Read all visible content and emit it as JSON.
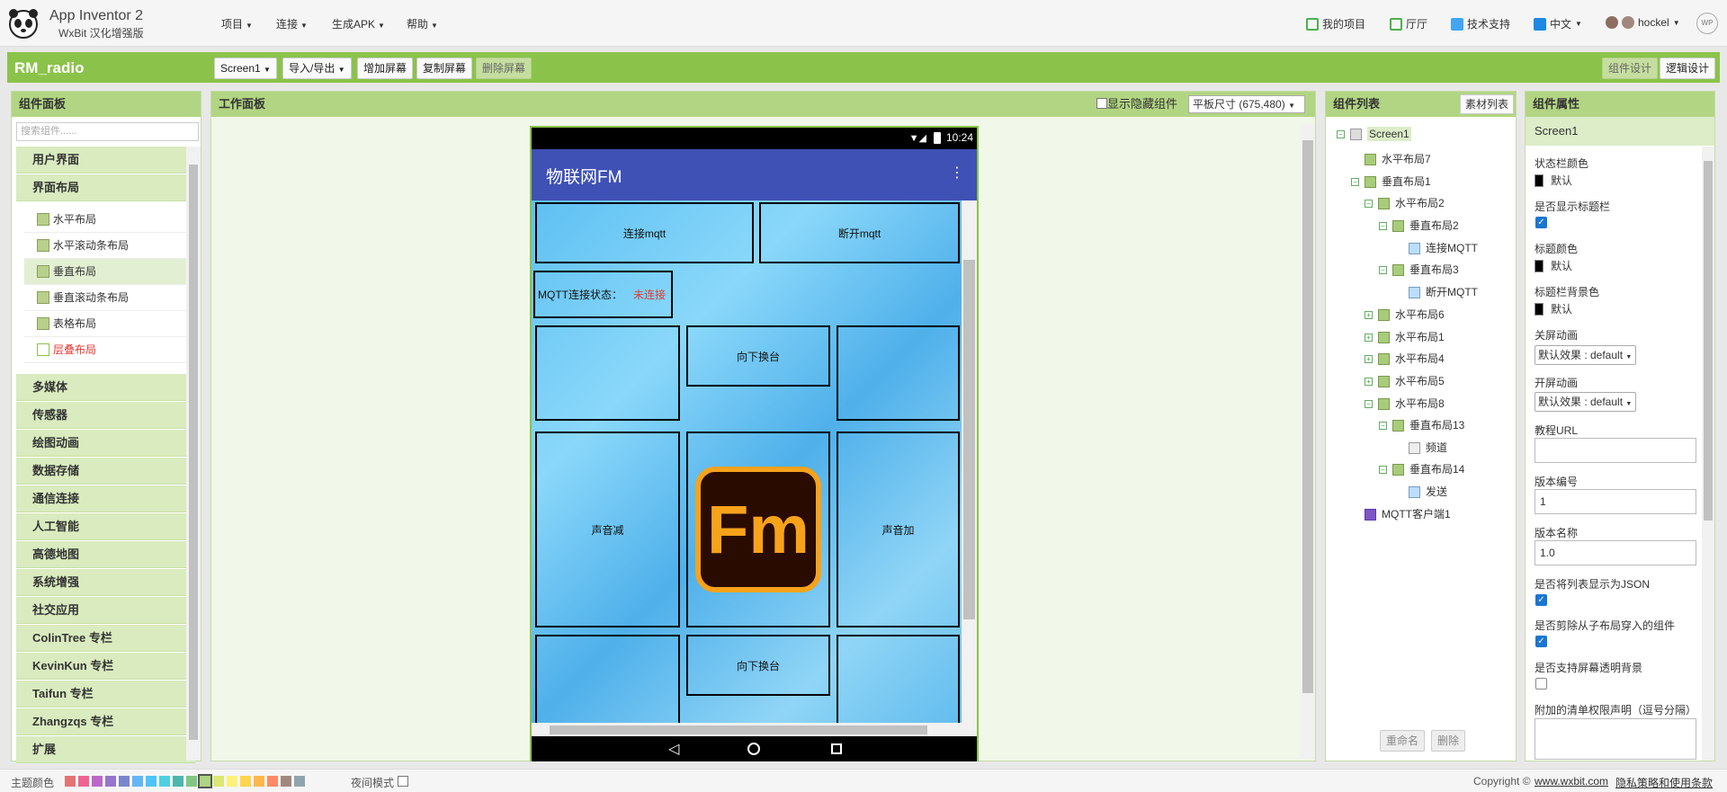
{
  "app": {
    "name": "App Inventor 2",
    "subtitle": "WxBit 汉化增强版"
  },
  "topmenu": [
    "项目",
    "连接",
    "生成APK",
    "帮助"
  ],
  "toplinks": {
    "projects": "我的项目",
    "gallery": "厅厅",
    "support": "技术支持",
    "language": "中文",
    "user": "hockel",
    "wp": "WP"
  },
  "project": {
    "name": "RM_radio",
    "screen": "Screen1",
    "import_export": "导入/导出",
    "add_screen": "增加屏幕",
    "copy_screen": "复制屏幕",
    "delete_screen": "删除屏幕",
    "designer": "组件设计",
    "blocks": "逻辑设计"
  },
  "palette": {
    "title": "组件面板",
    "search_placeholder": "搜索组件......",
    "categories": [
      "用户界面",
      "界面布局"
    ],
    "layout_items": [
      "水平布局",
      "水平滚动条布局",
      "垂直布局",
      "垂直滚动条布局",
      "表格布局",
      "层叠布局"
    ],
    "more_categories": [
      "多媒体",
      "传感器",
      "绘图动画",
      "数据存储",
      "通信连接",
      "人工智能",
      "高德地图",
      "系统增强",
      "社交应用",
      "ColinTree 专栏",
      "KevinKun 专栏",
      "Taifun 专栏",
      "Zhangzqs 专栏",
      "扩展"
    ],
    "help": "?"
  },
  "viewer": {
    "title": "工作面板",
    "show_hidden": "显示隐藏组件",
    "size": "平板尺寸 (675,480)"
  },
  "phone": {
    "time": "10:24",
    "title": "物联网FM",
    "connect": "连接mqtt",
    "disconnect": "断开mqtt",
    "status_label": "MQTT连接状态：",
    "status_value": "未连接",
    "channel_down": "向下换台",
    "vol_down": "声音减",
    "vol_up": "声音加",
    "channel_down2": "向下换台",
    "logo_text": "Fm"
  },
  "tree": {
    "title": "组件列表",
    "assets": "素材列表",
    "nodes": [
      "Screen1",
      "水平布局7",
      "垂直布局1",
      "水平布局2",
      "垂直布局2",
      "连接MQTT",
      "垂直布局3",
      "断开MQTT",
      "水平布局6",
      "水平布局1",
      "水平布局4",
      "水平布局5",
      "水平布局8",
      "垂直布局13",
      "频道",
      "垂直布局14",
      "发送",
      "MQTT客户端1"
    ],
    "rename": "重命名",
    "delete": "删除"
  },
  "props": {
    "title": "组件属性",
    "component": "Screen1",
    "statusbar_color": "状态栏颜色",
    "default": "默认",
    "show_title": "是否显示标题栏",
    "title_color": "标题颜色",
    "titlebar_bg": "标题栏背景色",
    "close_anim": "关屏动画",
    "open_anim": "开屏动画",
    "anim_value": "默认效果 : default",
    "tutorial_url": "教程URL",
    "version_code": "版本编号",
    "version_code_value": "1",
    "version_name": "版本名称",
    "version_name_value": "1.0",
    "list_json": "是否将列表显示为JSON",
    "cut_child": "是否剪除从子布局穿入的组件",
    "transparent_bg": "是否支持屏幕透明背景",
    "permissions": "附加的清单权限声明（逗号分隔）"
  },
  "footer": {
    "theme": "主题颜色",
    "night": "夜间模式",
    "copyright": "Copyright ©",
    "site": "www.wxbit.com",
    "privacy": "隐私策略和使用条款",
    "swatches": [
      "#e57373",
      "#f06292",
      "#ba68c8",
      "#9575cd",
      "#7986cb",
      "#64b5f6",
      "#4fc3f7",
      "#4dd0e1",
      "#4db6ac",
      "#81c784",
      "#aed581",
      "#dce775",
      "#fff176",
      "#ffd54f",
      "#ffb74d",
      "#ff8a65",
      "#a1887f",
      "#90a4ae"
    ]
  }
}
